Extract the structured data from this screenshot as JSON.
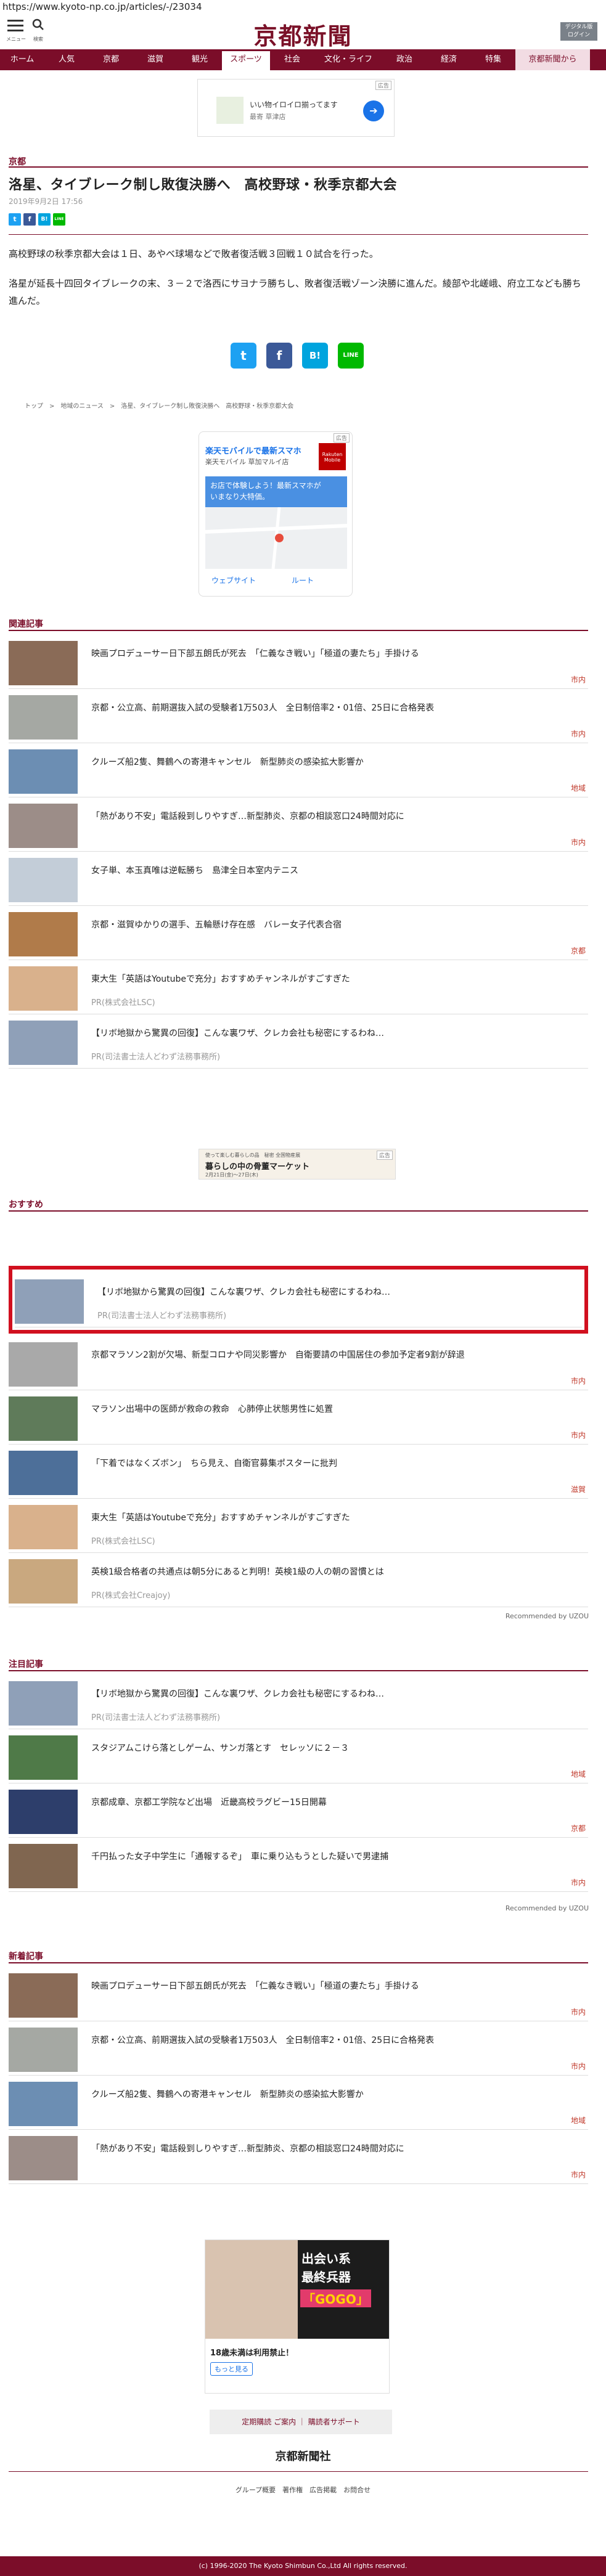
{
  "url": "https://www.kyoto-np.co.jp/articles/-/23034",
  "header": {
    "menu_label": "メニュー",
    "search_label": "検索",
    "logo": "京都新聞",
    "digital": "デジタル版\nログイン"
  },
  "nav": [
    "ホーム",
    "人気",
    "京都",
    "滋賀",
    "観光",
    "スポーツ",
    "社会",
    "文化・ライフ",
    "政治",
    "経済",
    "特集",
    "京都新聞から"
  ],
  "ad_top": {
    "tag": "広告",
    "line1": "いい物イロイロ揃ってます",
    "line2": "最寄 草津店"
  },
  "section_region": "京都",
  "article": {
    "title": "洛星、タイブレーク制し敗復決勝へ　高校野球・秋季京都大会",
    "date": "2019年9月2日 17:56",
    "p1": "高校野球の秋季京都大会は１日、あやべ球場などで敗者復活戦３回戦１０試合を行った。",
    "p2": "洛星が延長十四回タイブレークの末、３－２で洛西にサヨナラ勝ちし、敗者復活戦ゾーン決勝に進んだ。綾部や北嵯峨、府立工なども勝ち進んだ。"
  },
  "share": {
    "tw": "t",
    "fb": "f",
    "hb": "B!",
    "line": "LINE"
  },
  "breadcrumb": "トップ　>　地域のニュース　>　洛星、タイブレーク制し敗復決勝へ　高校野球・秋季京都大会",
  "ad_map": {
    "tag": "広告",
    "title": "楽天モバイルで最新スマホ",
    "sub": "楽天モバイル 草加マルイ店",
    "banner1": "お店で体験しよう！最新スマホが",
    "banner2": "いまなり大特価。",
    "web": "ウェブサイト",
    "route": "ルート",
    "brand": "Rakuten Mobile"
  },
  "related": {
    "heading": "関連記事",
    "items": [
      {
        "title": "映画プロデューサー日下部五朗氏が死去　「仁義なき戦い」「極道の妻たち」手掛ける",
        "tag": "市内"
      },
      {
        "title": "京都・公立高、前期選抜入試の受験者1万503人　全日制倍率2・01倍、25日に合格発表",
        "tag": "市内"
      },
      {
        "title": "クルーズ船2隻、舞鶴への寄港キャンセル　新型肺炎の感染拡大影響か",
        "tag": "地域"
      },
      {
        "title": "「熱があり不安」電話殺到しりやすぎ…新型肺炎、京都の相談窓口24時間対応に",
        "tag": "市内"
      },
      {
        "title": "女子単、本玉真唯は逆転勝ち　島津全日本室内テニス",
        "tag": ""
      },
      {
        "title": "京都・滋賀ゆかりの選手、五輪懸け存在感　バレー女子代表合宿",
        "tag": "京都"
      },
      {
        "title": "東大生「英語はYoutubeで充分」おすすめチャンネルがすごすぎた",
        "pr": "PR(株式会社LSC)"
      },
      {
        "title": "【リボ地獄から驚異の回復】こんな裏ワザ、クレカ会社も秘密にするわね…",
        "pr": "PR(司法書士法人どわず法務事務所)"
      }
    ]
  },
  "ad_mid": {
    "tag": "広告",
    "l1": "使って楽しむ暮らしの品　秘密 全国物産展",
    "l2": "暮らしの中の骨董マーケット",
    "l3": "2月21日(金)〜27日(木)"
  },
  "recommend": {
    "heading": "おすすめ",
    "items": [
      {
        "title": "【リボ地獄から驚異の回復】こんな裏ワザ、クレカ会社も秘密にするわね…",
        "pr": "PR(司法書士法人どわず法務事務所)"
      },
      {
        "title": "京都マラソン2割が欠場、新型コロナや同災影響か　自衛要請の中国居住の参加予定者9割が辞退",
        "tag": "市内"
      },
      {
        "title": "マラソン出場中の医師が救命の救命　心肺停止状態男性に処置",
        "tag": "市内"
      },
      {
        "title": "「下着ではなくズボン」　ちら見え、自衛官募集ポスターに批判",
        "tag": "滋賀"
      },
      {
        "title": "東大生「英語はYoutubeで充分」おすすめチャンネルがすごすぎた",
        "pr": "PR(株式会社LSC)"
      },
      {
        "title": "英検1級合格者の共通点は朝5分にあると判明！英検1級の人の朝の習慣とは",
        "pr": "PR(株式会社Creajoy)"
      }
    ],
    "brand": "Recommended by UZOU"
  },
  "attention": {
    "heading": "注目記事",
    "items": [
      {
        "title": "【リボ地獄から驚異の回復】こんな裏ワザ、クレカ会社も秘密にするわね…",
        "pr": "PR(司法書士法人どわず法務事務所)"
      },
      {
        "title": "スタジアムこけら落としゲーム、サンガ落とす　セレッソに２－３",
        "tag": "地域"
      },
      {
        "title": "京都成章、京都工学院など出場　近畿高校ラグビー15日開幕",
        "tag": "京都"
      },
      {
        "title": "千円払った女子中学生に「通報するぞ」　車に乗り込もうとした疑いで男逮捕",
        "tag": "市内"
      }
    ],
    "brand": "Recommended by UZOU"
  },
  "latest": {
    "heading": "新着記事",
    "items": [
      {
        "title": "映画プロデューサー日下部五朗氏が死去　「仁義なき戦い」「極道の妻たち」手掛ける",
        "tag": "市内"
      },
      {
        "title": "京都・公立高、前期選抜入試の受験者1万503人　全日制倍率2・01倍、25日に合格発表",
        "tag": "市内"
      },
      {
        "title": "クルーズ船2隻、舞鶴への寄港キャンセル　新型肺炎の感染拡大影響か",
        "tag": "地域"
      },
      {
        "title": "「熱があり不安」電話殺到しりやすぎ…新型肺炎、京都の相談窓口24時間対応に",
        "tag": "市内"
      }
    ]
  },
  "ad_bottom": {
    "l1": "出会い系",
    "l2": "最終兵器",
    "l3": "「GOGO」",
    "l4": "18歳未満は利用禁止！",
    "btn": "もっと見る"
  },
  "footer": {
    "links_top": "定期購読 ご案内 ｜ 購読者サポート",
    "logo": "京都新聞社",
    "links": "グループ概要　著作権　広告掲載　お問合せ",
    "copyright": "(c) 1996-2020 The Kyoto Shimbun Co.,Ltd All rights reserved."
  }
}
